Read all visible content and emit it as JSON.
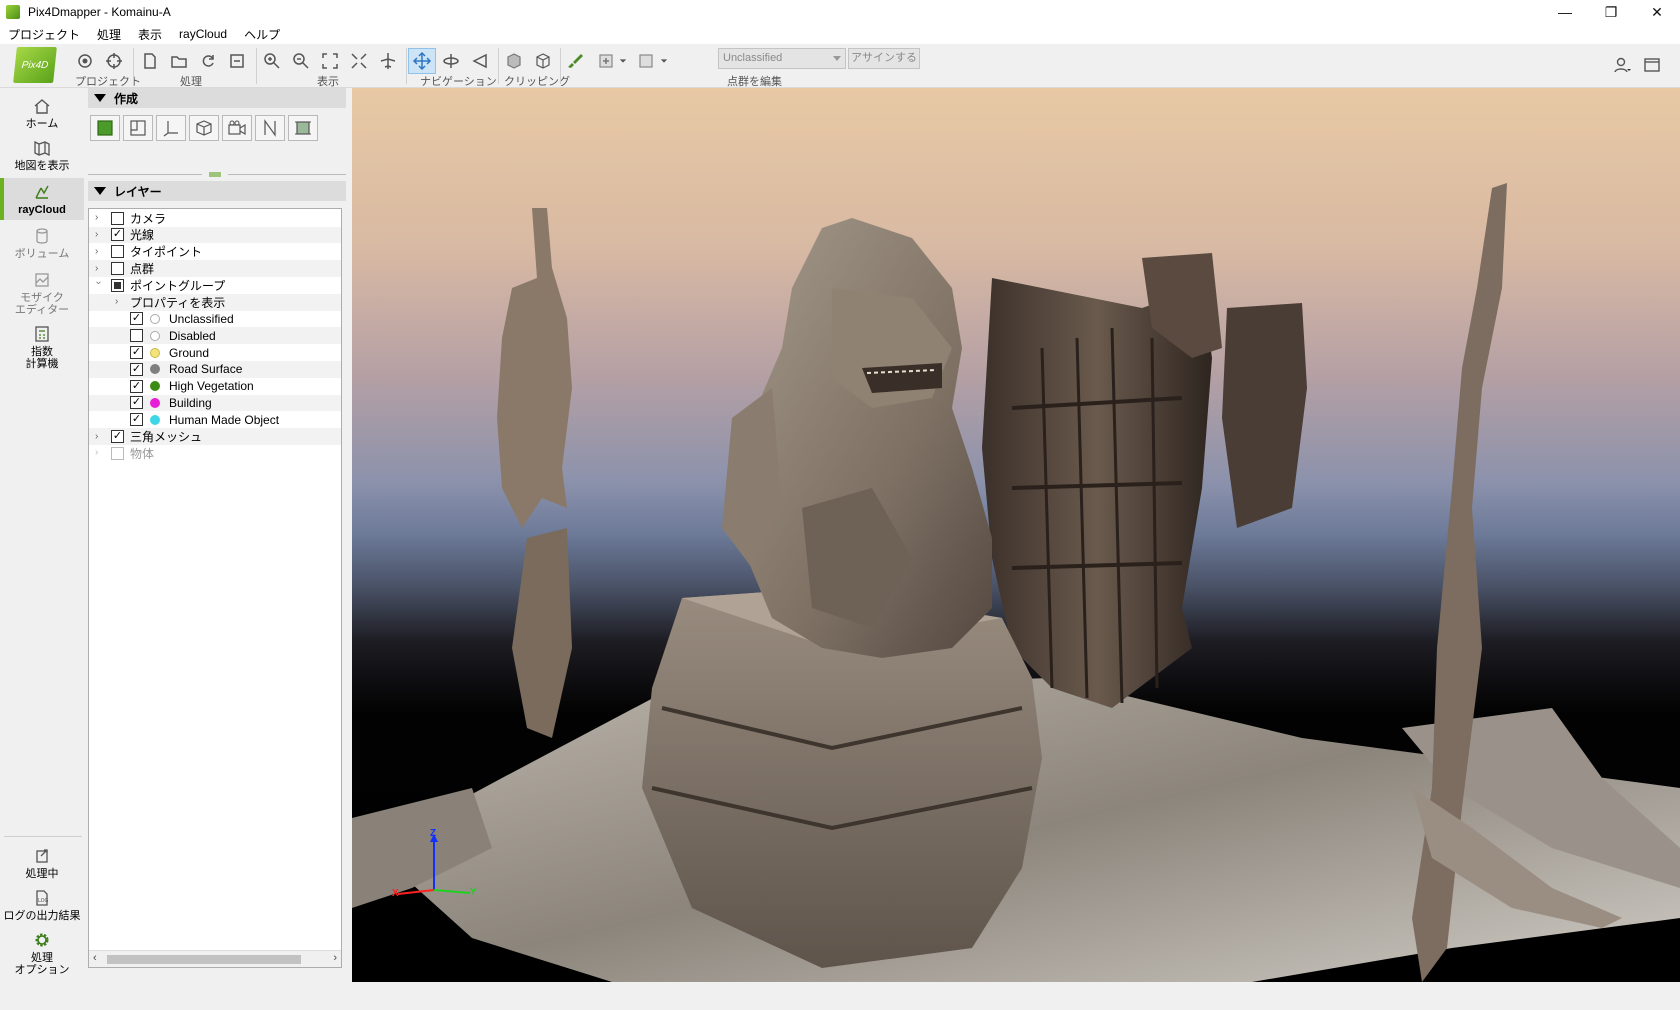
{
  "window": {
    "title": "Pix4Dmapper - Komainu-A"
  },
  "menu": {
    "items": [
      "プロジェクト",
      "処理",
      "表示",
      "rayCloud",
      "ヘルプ"
    ]
  },
  "toolbar": {
    "logo_text": "Pix4D",
    "groups": {
      "project": "プロジェクト",
      "processing": "処理",
      "view": "表示",
      "navigation": "ナビゲーション",
      "clipping": "クリッピング",
      "edit_points": "点群を編集"
    },
    "class_select": {
      "value": "Unclassified"
    },
    "assign_button": "アサインする"
  },
  "leftnav": {
    "home": "ホーム",
    "map": "地図を表示",
    "raycloud": "rayCloud",
    "volume": "ボリューム",
    "mosaic_line1": "モザイク",
    "mosaic_line2": "エディター",
    "index_line1": "指数",
    "index_line2": "計算機",
    "processing": "処理中",
    "log": "ログの出力結果",
    "options_line1": "処理",
    "options_line2": "オプション"
  },
  "panel": {
    "create_title": "作成",
    "layers_title": "レイヤー",
    "layers": [
      {
        "label": "カメラ",
        "checked": false
      },
      {
        "label": "光線",
        "checked": true
      },
      {
        "label": "タイポイント",
        "checked": false
      },
      {
        "label": "点群",
        "checked": false
      },
      {
        "label": "ポイントグループ",
        "checked": "partial"
      },
      {
        "label": "プロパティを表示"
      },
      {
        "label": "Unclassified",
        "checked": true,
        "color": "#ffffff"
      },
      {
        "label": "Disabled",
        "checked": false,
        "color": "#ffffff"
      },
      {
        "label": "Ground",
        "checked": true,
        "color": "#f3e47a"
      },
      {
        "label": "Road Surface",
        "checked": true,
        "color": "#7f7f7f"
      },
      {
        "label": "High Vegetation",
        "checked": true,
        "color": "#3c8c14"
      },
      {
        "label": "Building",
        "checked": true,
        "color": "#e81ed6"
      },
      {
        "label": "Human Made Object",
        "checked": true,
        "color": "#3cd6e6"
      },
      {
        "label": "三角メッシュ",
        "checked": true
      },
      {
        "label": "物体",
        "checked": false
      }
    ]
  },
  "viewport": {
    "axis": {
      "x": "X",
      "y": "Y",
      "z": "Z"
    }
  }
}
